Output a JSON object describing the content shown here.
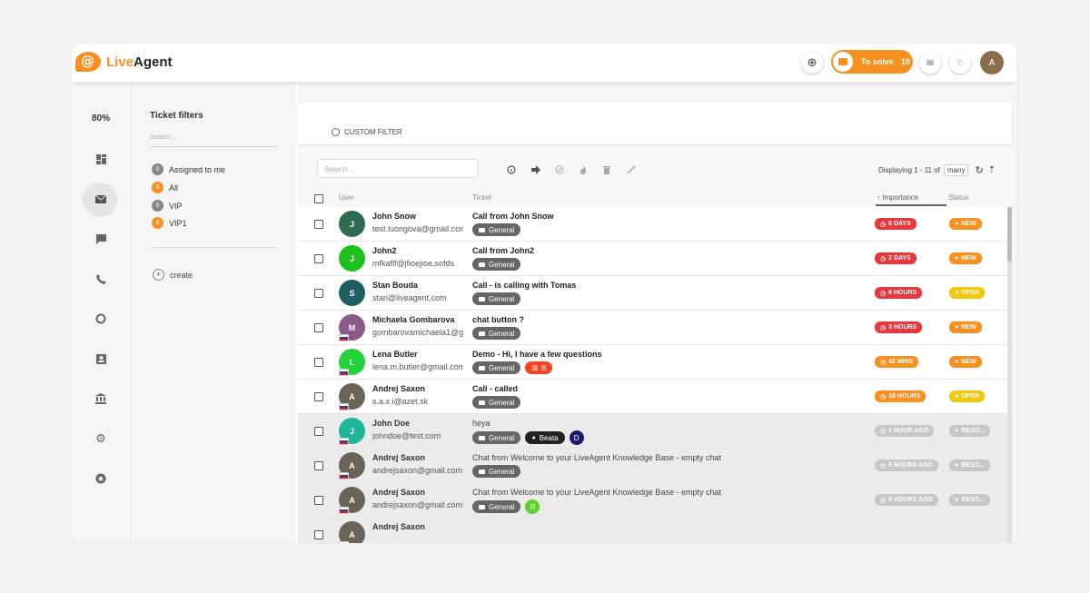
{
  "brand": {
    "name_a": "Live",
    "name_b": "Agent"
  },
  "topbar": {
    "to_solve_label": "To solve",
    "to_solve_count": "10",
    "avatar": "A"
  },
  "nav": {
    "zoom": "80%"
  },
  "filters": {
    "title": "Ticket filters",
    "search_placeholder": "Search ...",
    "items": [
      {
        "count": "0",
        "label": "Assigned to me",
        "color": "#888888"
      },
      {
        "count": "6",
        "label": "All",
        "color": "#f7901e"
      },
      {
        "count": "0",
        "label": "VIP",
        "color": "#888888"
      },
      {
        "count": "8",
        "label": "VIP1",
        "color": "#f7901e"
      }
    ],
    "create_label": "create"
  },
  "custom_filter": {
    "label": "CUSTOM FILTER"
  },
  "list": {
    "search_placeholder": "Search ...",
    "display_text": "Displaying 1 - 11 of",
    "display_many": "many",
    "headers": {
      "user": "User",
      "ticket": "Ticket",
      "importance": "↑ Importance",
      "status": "Status"
    },
    "rows": [
      {
        "name": "John Snow",
        "email": "test.luongova@gmail.com",
        "initial": "J",
        "avatar_color": "#2e6b4f",
        "subject": "Call from John Snow",
        "tags": [
          "General"
        ],
        "importance": "8 DAYS",
        "imp_color": "#e8383d",
        "status": "NEW",
        "status_color": "#f7901e",
        "shade": "white"
      },
      {
        "name": "John2",
        "email": "mfkaflf@jfioejioe.sofds",
        "initial": "J",
        "avatar_color": "#1ec01e",
        "subject": "Call from John2",
        "tags": [
          "General"
        ],
        "importance": "2 DAYS",
        "imp_color": "#e8383d",
        "status": "NEW",
        "status_color": "#f7901e",
        "shade": "white"
      },
      {
        "name": "Stan Bouda",
        "email": "stan@liveagent.com",
        "initial": "S",
        "avatar_color": "#1d5e63",
        "subject": "Call - is calling with Tomas",
        "tags": [
          "General"
        ],
        "importance": "6 HOURS",
        "imp_color": "#e8383d",
        "status": "OPEN",
        "status_color": "#f2c80c",
        "shade": "white"
      },
      {
        "name": "Michaela Gombarova",
        "email": "gombarovamichaela1@gmail.com",
        "initial": "M",
        "avatar_color": "#8a5a8a",
        "subject": "chat button ?",
        "tags": [
          "General"
        ],
        "importance": "3 HOURS",
        "imp_color": "#e8383d",
        "status": "NEW",
        "status_color": "#f7901e",
        "shade": "white"
      },
      {
        "name": "Lena Butler",
        "email": "lena.m.butler@gmail.com",
        "initial": "L",
        "avatar_color": "#22d33a",
        "subject": "Demo - Hi, I have a few questions",
        "tags": [
          "General"
        ],
        "extra_tag": "B",
        "importance": "42 MINS",
        "imp_color": "#f7901e",
        "status": "NEW",
        "status_color": "#f7901e",
        "shade": "white"
      },
      {
        "name": "Andrej Saxon",
        "email": "s.a.x.i@azet.sk",
        "initial": "A",
        "avatar_color": "#6b6258",
        "subject": "Call - called",
        "tags": [
          "General"
        ],
        "importance": "18 HOURS",
        "imp_color": "#f7901e",
        "status": "OPEN",
        "status_color": "#f2c80c",
        "shade": "white"
      },
      {
        "name": "John Doe",
        "email": "johndoe@test.com",
        "initial": "J",
        "avatar_color": "#1fb59a",
        "subject": "heya",
        "tags": [
          "General"
        ],
        "beata": "Beata",
        "circle": {
          "text": "D",
          "color": "#1a1a6e"
        },
        "importance": "1 HOUR AGO",
        "imp_color": "#c7c7c7",
        "status": "RESO...",
        "status_color": "#c7c7c7",
        "shade": "gray"
      },
      {
        "name": "Andrej Saxon",
        "email": "andrejsaxon@gmail.com",
        "initial": "A",
        "avatar_color": "#6b6258",
        "subject": "Chat from Welcome to your LiveAgent Knowledge Base - empty chat",
        "tags": [
          "General"
        ],
        "importance": "5 HOURS AGO",
        "imp_color": "#c7c7c7",
        "status": "RESO...",
        "status_color": "#c7c7c7",
        "shade": "gray"
      },
      {
        "name": "Andrej Saxon",
        "email": "andrejsaxon@gmail.com",
        "initial": "A",
        "avatar_color": "#6b6258",
        "subject": "Chat from Welcome to your LiveAgent Knowledge Base - empty chat",
        "tags": [
          "General"
        ],
        "circle": {
          "text": "R",
          "color": "#5cd12b"
        },
        "importance": "6 HOURS AGO",
        "imp_color": "#c7c7c7",
        "status": "RESO...",
        "status_color": "#c7c7c7",
        "shade": "gray"
      },
      {
        "name": "Andrej Saxon",
        "email": "",
        "initial": "A",
        "avatar_color": "#6b6258",
        "subject": "",
        "tags": [],
        "importance": "",
        "imp_color": "#c7c7c7",
        "status": "",
        "status_color": "#c7c7c7",
        "shade": "gray"
      }
    ]
  }
}
